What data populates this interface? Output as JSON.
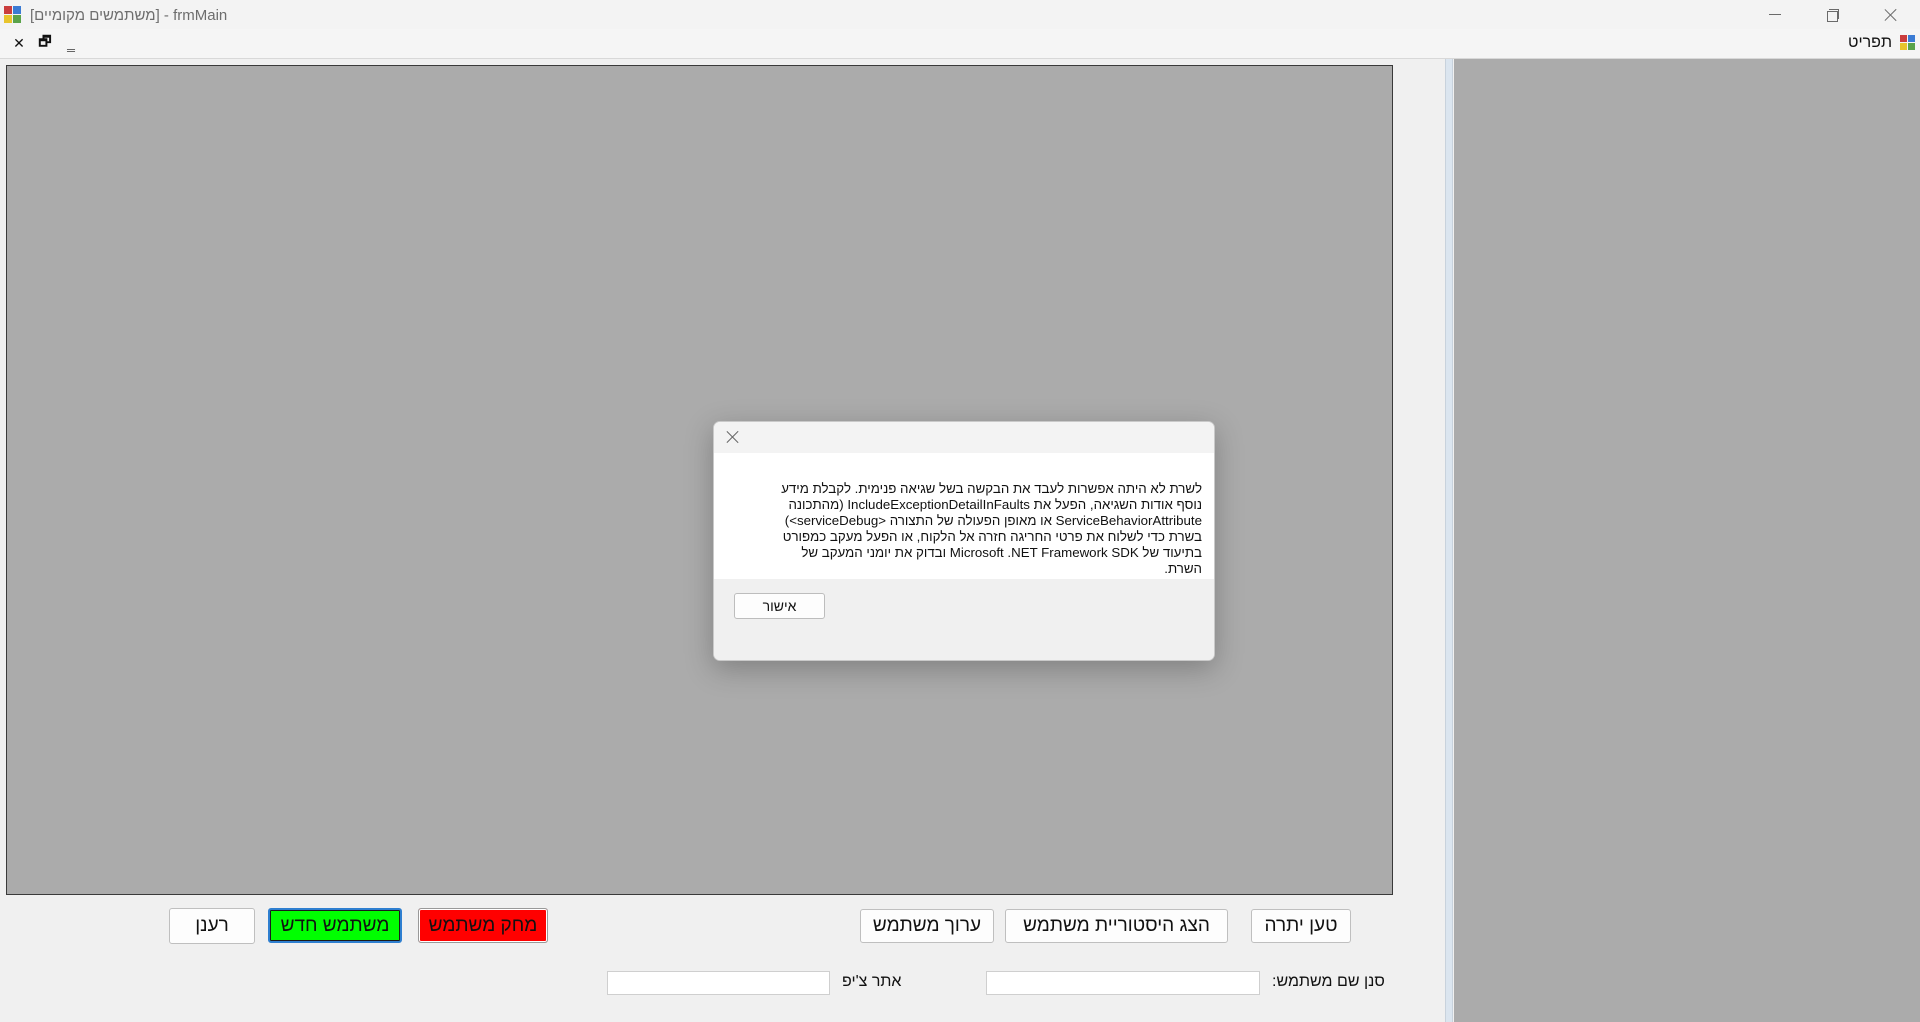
{
  "window": {
    "title": "[משתמשים מקומיים] - frmMain",
    "minimize_label": "",
    "restore_label": "",
    "close_label": ""
  },
  "menu": {
    "print_label": "תפריט"
  },
  "buttons": {
    "load_site": "טען יתרה",
    "show_history": "הצג היסטוריית משתמש",
    "edit_user": "ערוך משתמש",
    "delete_user": "מחק משתמש",
    "new_user": "משתמש חדש",
    "refresh": "רענן"
  },
  "filters": {
    "user_name_label": "סנן שם משתמש:",
    "user_name_value": "",
    "site_label": "אתר צ'יפ",
    "site_value": ""
  },
  "dialog": {
    "message": "לשרת לא היתה אפשרות לעבד את הבקשה בשל שגיאה פנימית. לקבלת מידע\nנוסף אודות השגיאה, הפעל את IncludeExceptionDetailInFaults (מהתכונה\nServiceBehaviorAttribute או מאופן הפעולה של התצורה  <serviceDebug>)\nבשרת כדי לשלוח את פרטי החריגה חזרה אל הלקוח, או הפעל מעקב כמפורט\nבתיעוד של Microsoft .NET Framework SDK ובדוק את יומני המעקב של\nהשרת.",
    "ok_label": "אישור"
  },
  "colors": {
    "panel_gray": "#ababab",
    "new_user_green": "#00ff00",
    "delete_user_red": "#ff0000",
    "focus_blue": "#2f7fd0"
  }
}
